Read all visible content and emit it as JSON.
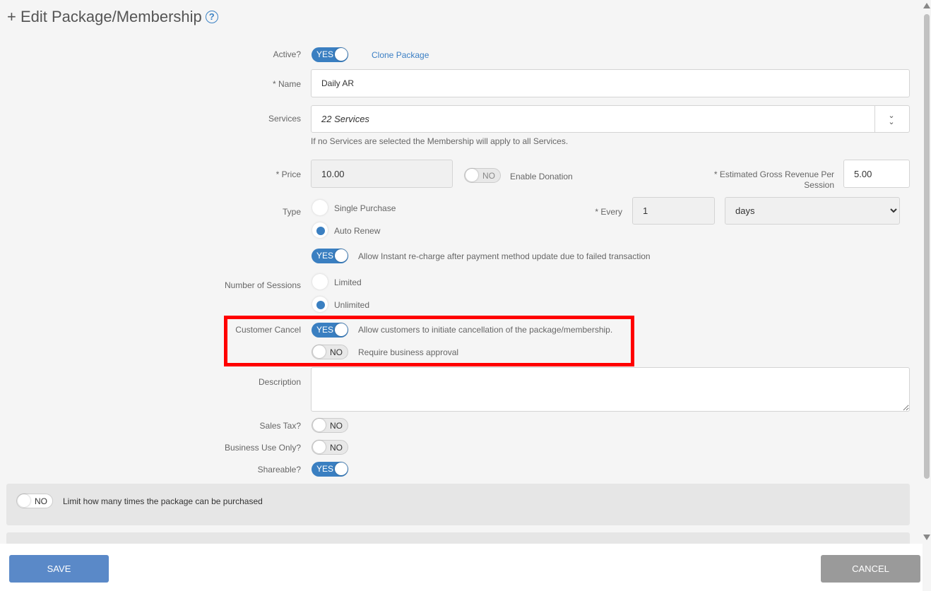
{
  "title": "+ Edit Package/Membership",
  "help_icon": "question-circle-icon",
  "active": {
    "label": "Active?",
    "toggle": "YES",
    "clone_link": "Clone Package"
  },
  "name": {
    "label": "* Name",
    "value": "Daily AR"
  },
  "services": {
    "label": "Services",
    "value": "22 Services",
    "hint": "If no Services are selected the Membership will apply to all Services.",
    "icon": "double-chevron-down-icon"
  },
  "price": {
    "label": "* Price",
    "value": "10.00",
    "donation_toggle": "NO",
    "donation_label": "Enable Donation",
    "gross_label": "* Estimated Gross Revenue Per Session",
    "gross_value": "5.00"
  },
  "type": {
    "label": "Type",
    "options": [
      "Single Purchase",
      "Auto Renew"
    ],
    "selected": "Auto Renew",
    "every_label": "* Every",
    "every_value": "1",
    "period": "days"
  },
  "instant_recharge": {
    "toggle": "YES",
    "label": "Allow Instant re-charge after payment method update due to failed transaction"
  },
  "sessions": {
    "label": "Number of Sessions",
    "options": [
      "Limited",
      "Unlimited"
    ],
    "selected": "Unlimited"
  },
  "customer_cancel": {
    "label": "Customer Cancel",
    "toggle": "YES",
    "text": "Allow customers to initiate cancellation of the package/membership.",
    "approval_toggle": "NO",
    "approval_text": "Require business approval"
  },
  "description": {
    "label": "Description",
    "value": ""
  },
  "sales_tax": {
    "label": "Sales Tax?",
    "toggle": "NO"
  },
  "business_use": {
    "label": "Business Use Only?",
    "toggle": "NO"
  },
  "shareable": {
    "label": "Shareable?",
    "toggle": "YES"
  },
  "limit_panel": {
    "toggle": "NO",
    "text": "Limit how many times the package can be purchased"
  },
  "footer": {
    "save": "SAVE",
    "cancel": "CANCEL"
  },
  "colors": {
    "accent": "#3a7fc1",
    "highlight": "#ff0000",
    "save": "#5a89c8",
    "cancel": "#9a9a9a"
  }
}
